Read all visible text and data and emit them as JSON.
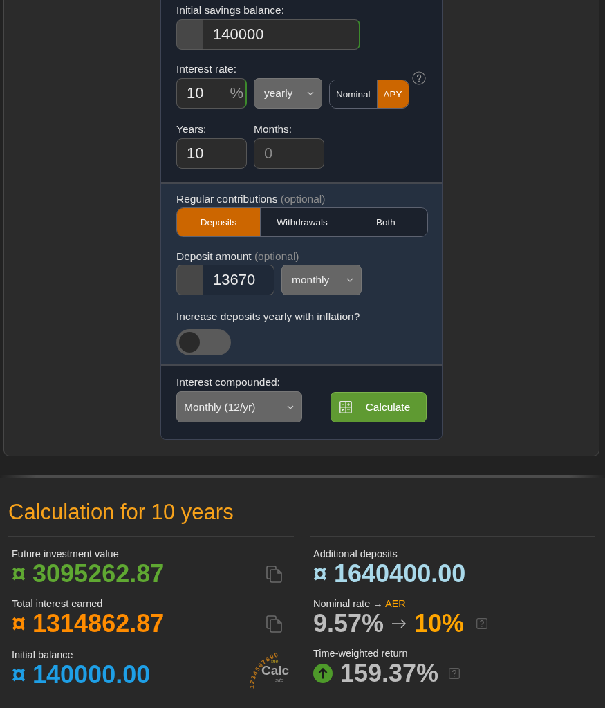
{
  "savings_form": {
    "initial_balance": {
      "label": "Initial savings balance:",
      "value": "140000",
      "valid": true
    },
    "interest_rate": {
      "label": "Interest rate:",
      "value": "10",
      "unit": "%",
      "valid": true,
      "period": "yearly",
      "rate_types": [
        {
          "label": "Nominal",
          "selected": false
        },
        {
          "label": "APY",
          "selected": true
        }
      ]
    },
    "term": [
      {
        "label": "Years:",
        "value": "10"
      },
      {
        "label": "Months:",
        "placeholder": "0"
      }
    ]
  },
  "contributions": {
    "label": "Regular contributions",
    "note": "(optional)",
    "modes": [
      {
        "label": "Deposits",
        "selected": true
      },
      {
        "label": "Withdrawals",
        "selected": false
      },
      {
        "label": "Both",
        "selected": false
      }
    ],
    "amount": {
      "label": "Deposit amount",
      "note": "(optional)",
      "value": "13670",
      "frequency": "monthly"
    },
    "inflation": {
      "label": "Increase deposits yearly with inflation?",
      "on": false
    }
  },
  "compounding": {
    "label": "Interest compounded:",
    "value": "Monthly (12/yr)"
  },
  "calculate_button": "Calculate",
  "results": {
    "title": "Calculation for 10 years",
    "left": [
      {
        "label": "Future investment value",
        "currency": "¤",
        "value": "3095262.87",
        "color": "#5fa832",
        "copyable": true
      },
      {
        "label": "Total interest earned",
        "currency": "¤",
        "value": "1314862.87",
        "color": "#ff8c00",
        "copyable": true
      },
      {
        "label": "Initial balance",
        "currency": "¤",
        "value": "140000.00",
        "color": "#1e9fe6",
        "copyable": false
      }
    ],
    "logo": {
      "digits": "1234567890",
      "prefix": "the",
      "name": "Calc",
      "suffix": "site"
    },
    "right": [
      {
        "kind": "amount",
        "label": "Additional deposits",
        "currency": "¤",
        "value": "1640400.00",
        "color": "#a9d9ea"
      },
      {
        "kind": "rate_change",
        "label": "Nominal rate →",
        "label_accent": "AER",
        "from": "9.57%",
        "to": "10%"
      },
      {
        "kind": "return",
        "label": "Time-weighted return",
        "rising": true,
        "value": "159.37%"
      }
    ]
  }
}
